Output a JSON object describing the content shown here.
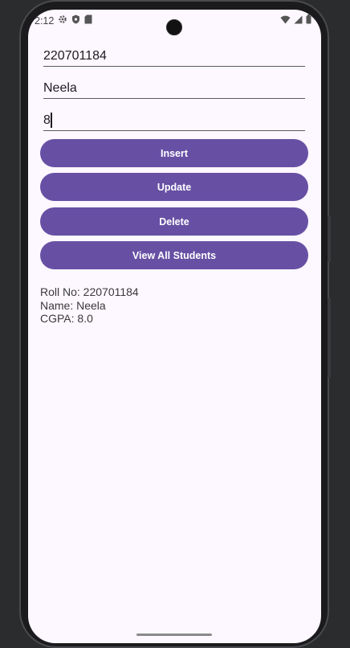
{
  "status_bar": {
    "time": "2:12",
    "icons_left": [
      "settings-icon",
      "shield-icon",
      "sd-card-icon"
    ],
    "icons_right": [
      "wifi-icon",
      "signal-icon",
      "battery-icon"
    ]
  },
  "form": {
    "roll_no_value": "220701184",
    "name_value": "Neela",
    "cgpa_value": "8"
  },
  "buttons": {
    "insert_label": "Insert",
    "update_label": "Update",
    "delete_label": "Delete",
    "view_all_label": "View All Students"
  },
  "result": {
    "roll_line": "Roll No: 220701184",
    "name_line": "Name: Neela",
    "cgpa_line": "CGPA: 8.0"
  },
  "colors": {
    "accent": "#6750a4",
    "background": "#fdf7ff",
    "device_frame": "#1b1b1d"
  }
}
